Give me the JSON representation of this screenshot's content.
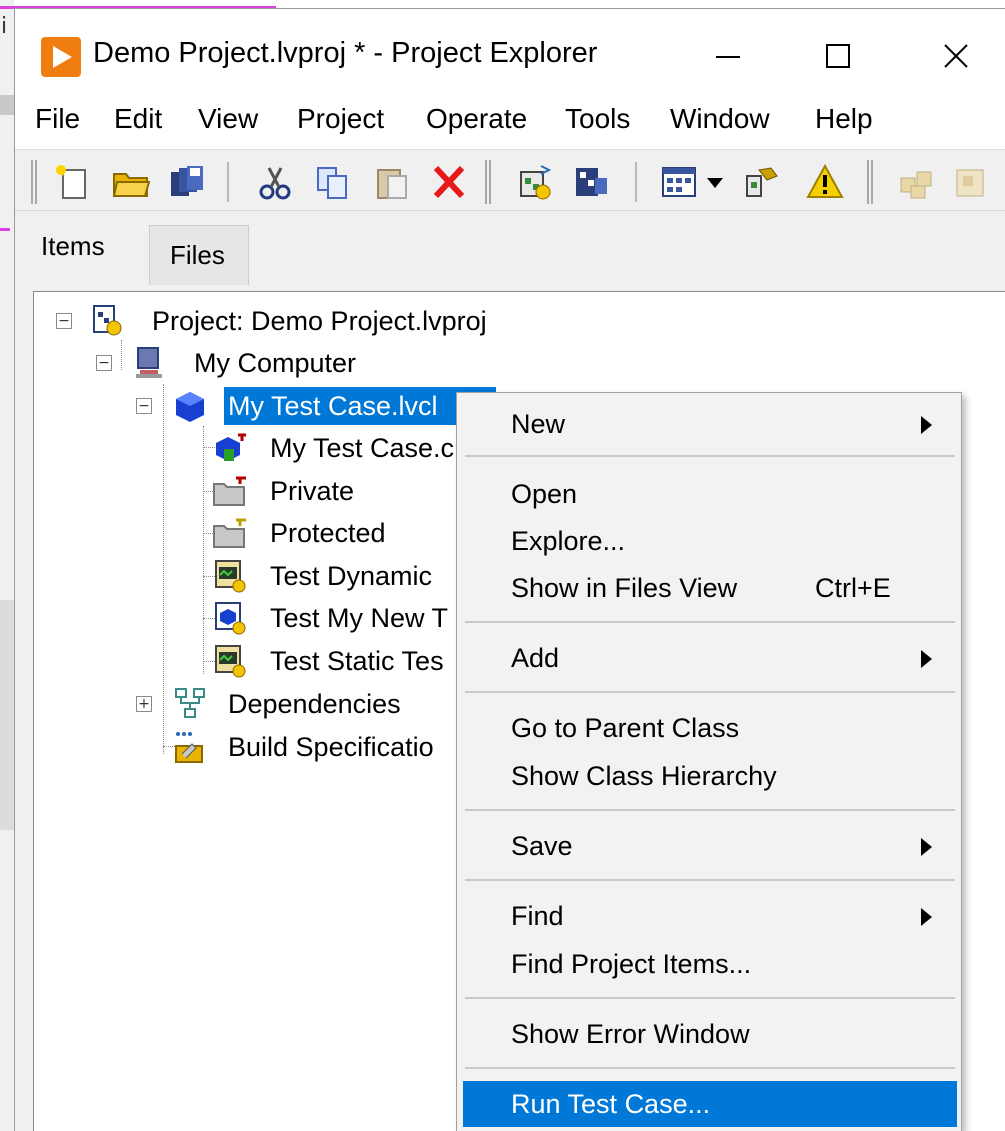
{
  "window": {
    "title": "Demo Project.lvproj * - Project Explorer",
    "controls": {
      "minimize": "—",
      "maximize": "☐",
      "close": "✕"
    }
  },
  "menubar": [
    "File",
    "Edit",
    "View",
    "Project",
    "Operate",
    "Tools",
    "Window",
    "Help"
  ],
  "toolbar": {
    "icons": [
      "new-icon",
      "open-icon",
      "save-all-icon",
      "cut-icon",
      "copy-icon",
      "paste-icon",
      "delete-icon",
      "build-icon",
      "deploy-icon",
      "view-icon",
      "dropdown-icon",
      "source-control-icon",
      "warning-icon",
      "package-icon",
      "package-alt-icon"
    ]
  },
  "tabs": {
    "items": "Items",
    "files": "Files"
  },
  "tree": {
    "project": "Project: Demo Project.lvproj",
    "computer": "My Computer",
    "test_case_class": "My Test Case.lvcl",
    "children": [
      "My Test Case.c",
      "Private",
      "Protected",
      "Test Dynamic",
      "Test My New T",
      "Test Static Tes"
    ],
    "dependencies": "Dependencies",
    "build_specs": "Build Specificatio"
  },
  "context_menu": {
    "new": "New",
    "open": "Open",
    "explore": "Explore...",
    "show_in_files": "Show in Files View",
    "show_in_files_shortcut": "Ctrl+E",
    "add": "Add",
    "goto_parent": "Go to Parent Class",
    "show_hierarchy": "Show Class Hierarchy",
    "save": "Save",
    "find": "Find",
    "find_project_items": "Find Project Items...",
    "show_error_window": "Show Error Window",
    "run_test_case": "Run Test Case..."
  },
  "colors": {
    "selection": "#0078d7",
    "app_icon": "#ef7d10"
  }
}
